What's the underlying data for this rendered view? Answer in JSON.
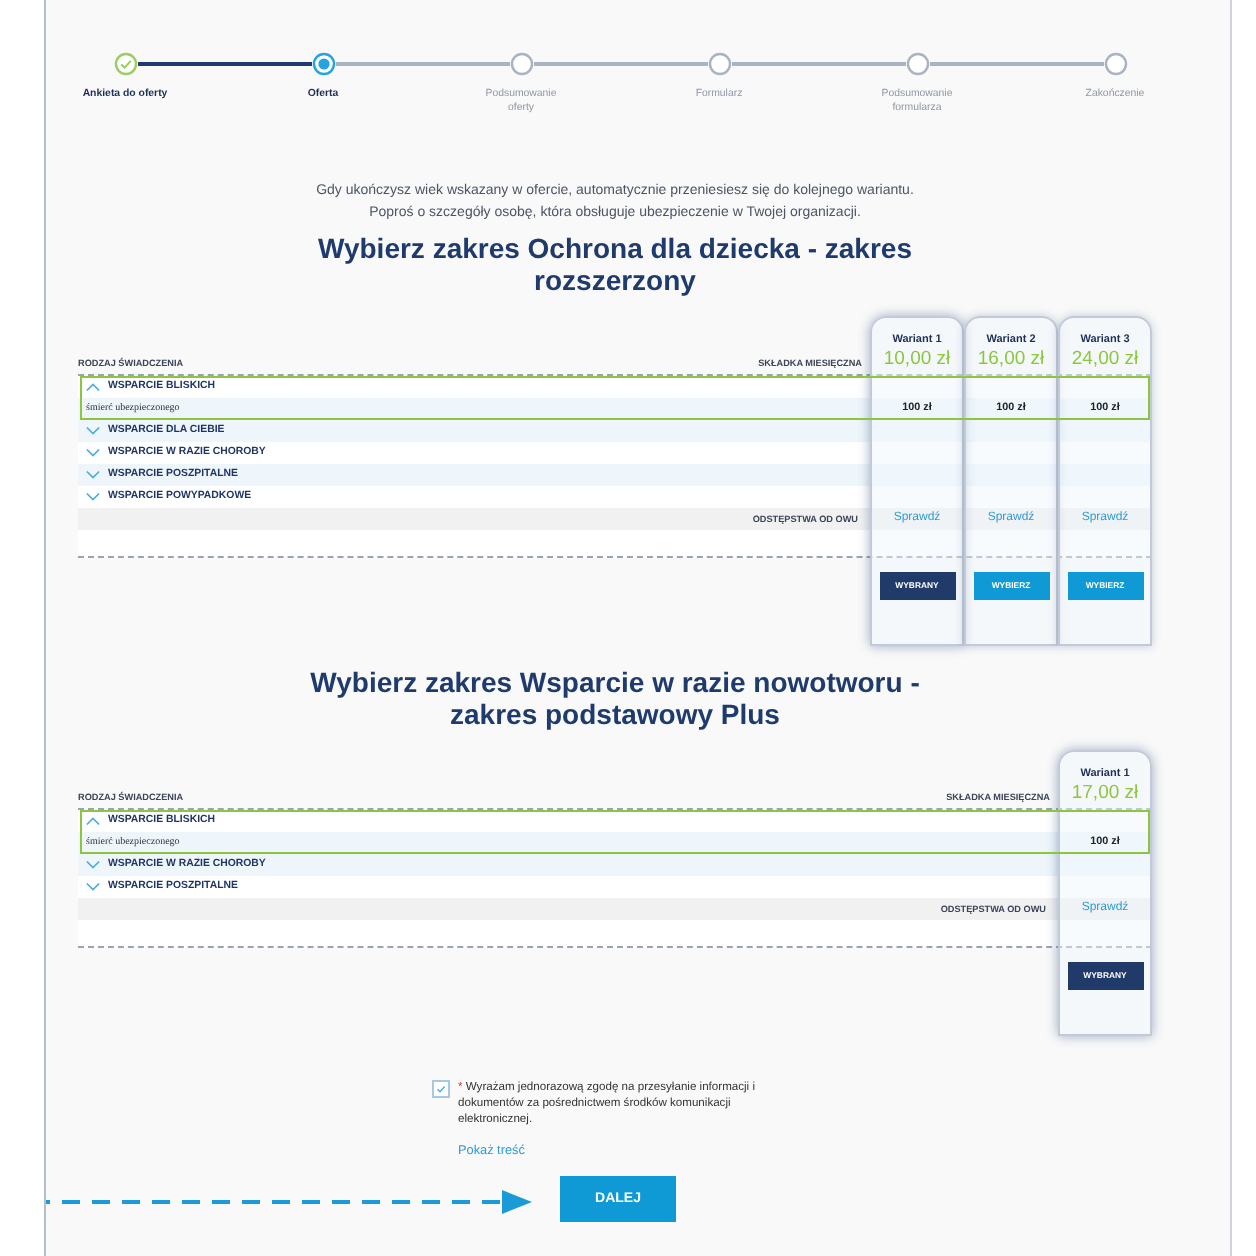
{
  "steps": [
    {
      "label": "Ankieta do oferty",
      "completed": true,
      "selected": false
    },
    {
      "label": "Oferta",
      "completed": false,
      "selected": true
    },
    {
      "label": "Podsumowanie oferty",
      "completed": false,
      "selected": false
    },
    {
      "label": "Formularz",
      "completed": false,
      "selected": false
    },
    {
      "label": "Podsumowanie formularza",
      "completed": false,
      "selected": false
    },
    {
      "label": "Zakończenie",
      "completed": false,
      "selected": false
    }
  ],
  "notice": [
    "Gdy ukończysz wiek wskazany w ofercie, automatycznie przeniesiesz się do kolejnego wariantu.",
    "Poproś o szczegóły osobę, która obsługuje ubezpieczenie w Twojej organizacji."
  ],
  "sections": [
    {
      "title": "Wybierz zakres Ochrona dla dziecka - zakres rozszerzony",
      "benefit_header": "RODZAJ ŚWIADCZENIA",
      "premium_header": "SKŁADKA MIESIĘCZNA",
      "variants": [
        {
          "name": "Wariant 1",
          "price": "10,00 zł",
          "selected": true,
          "button": "WYBRANY"
        },
        {
          "name": "Wariant 2",
          "price": "16,00 zł",
          "selected": false,
          "button": "WYBIERZ"
        },
        {
          "name": "Wariant 3",
          "price": "24,00 zł",
          "selected": false,
          "button": "WYBIERZ"
        }
      ],
      "groups": [
        {
          "label": "WSPARCIE BLISKICH",
          "expanded": true,
          "items": [
            {
              "label": "śmierć ubezpieczonego",
              "values": [
                "100 zł",
                "100 zł",
                "100 zł"
              ]
            }
          ]
        },
        {
          "label": "WSPARCIE DLA CIEBIE",
          "expanded": false
        },
        {
          "label": "WSPARCIE W RAZIE CHOROBY",
          "expanded": false
        },
        {
          "label": "WSPARCIE POSZPITALNE",
          "expanded": false
        },
        {
          "label": "WSPARCIE POWYPADKOWE",
          "expanded": false
        }
      ],
      "exceptions": {
        "label": "ODSTĘPSTWA OD OWU",
        "links": [
          "Sprawdź",
          "Sprawdź",
          "Sprawdź"
        ]
      }
    },
    {
      "title": "Wybierz zakres Wsparcie w razie nowotworu - zakres podstawowy Plus",
      "benefit_header": "RODZAJ ŚWIADCZENIA",
      "premium_header": "SKŁADKA MIESIĘCZNA",
      "variants": [
        {
          "name": "Wariant 1",
          "price": "17,00 zł",
          "selected": true,
          "button": "WYBRANY"
        }
      ],
      "groups": [
        {
          "label": "WSPARCIE BLISKICH",
          "expanded": true,
          "items": [
            {
              "label": "śmierć ubezpieczonego",
              "values": [
                "100 zł"
              ]
            }
          ]
        },
        {
          "label": "WSPARCIE W RAZIE CHOROBY",
          "expanded": false
        },
        {
          "label": "WSPARCIE POSZPITALNE",
          "expanded": false
        }
      ],
      "exceptions": {
        "label": "ODSTĘPSTWA OD OWU",
        "links": [
          "Sprawdź"
        ]
      }
    }
  ],
  "consent": {
    "checked": true,
    "required_mark": "*",
    "text": "Wyrażam jednorazową zgodę na przesyłanie informacji i dokumentów za pośrednictwem środków komunikacji elektronicznej.",
    "link": "Pokaż treść"
  },
  "next_button": "DALEJ"
}
